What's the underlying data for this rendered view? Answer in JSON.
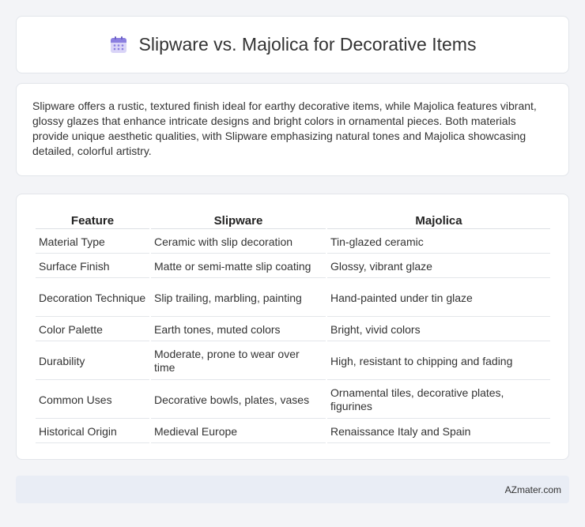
{
  "header": {
    "title": "Slipware vs. Majolica for Decorative Items",
    "icon": "calendar-icon",
    "accent_color": "#8b7fe0"
  },
  "summary": {
    "text": "Slipware offers a rustic, textured finish ideal for earthy decorative items, while Majolica features vibrant, glossy glazes that enhance intricate designs and bright colors in ornamental pieces. Both materials provide unique aesthetic qualities, with Slipware emphasizing natural tones and Majolica showcasing detailed, colorful artistry."
  },
  "table": {
    "headers": [
      "Feature",
      "Slipware",
      "Majolica"
    ],
    "rows": [
      [
        "Material Type",
        "Ceramic with slip decoration",
        "Tin-glazed ceramic"
      ],
      [
        "Surface Finish",
        "Matte or semi-matte slip coating",
        "Glossy, vibrant glaze"
      ],
      [
        "Decoration Technique",
        "Slip trailing, marbling, painting",
        "Hand-painted under tin glaze"
      ],
      [
        "Color Palette",
        "Earth tones, muted colors",
        "Bright, vivid colors"
      ],
      [
        "Durability",
        "Moderate, prone to wear over time",
        "High, resistant to chipping and fading"
      ],
      [
        "Common Uses",
        "Decorative bowls, plates, vases",
        "Ornamental tiles, decorative plates, figurines"
      ],
      [
        "Historical Origin",
        "Medieval Europe",
        "Renaissance Italy and Spain"
      ]
    ]
  },
  "footer": {
    "brand": "AZmater.com"
  }
}
